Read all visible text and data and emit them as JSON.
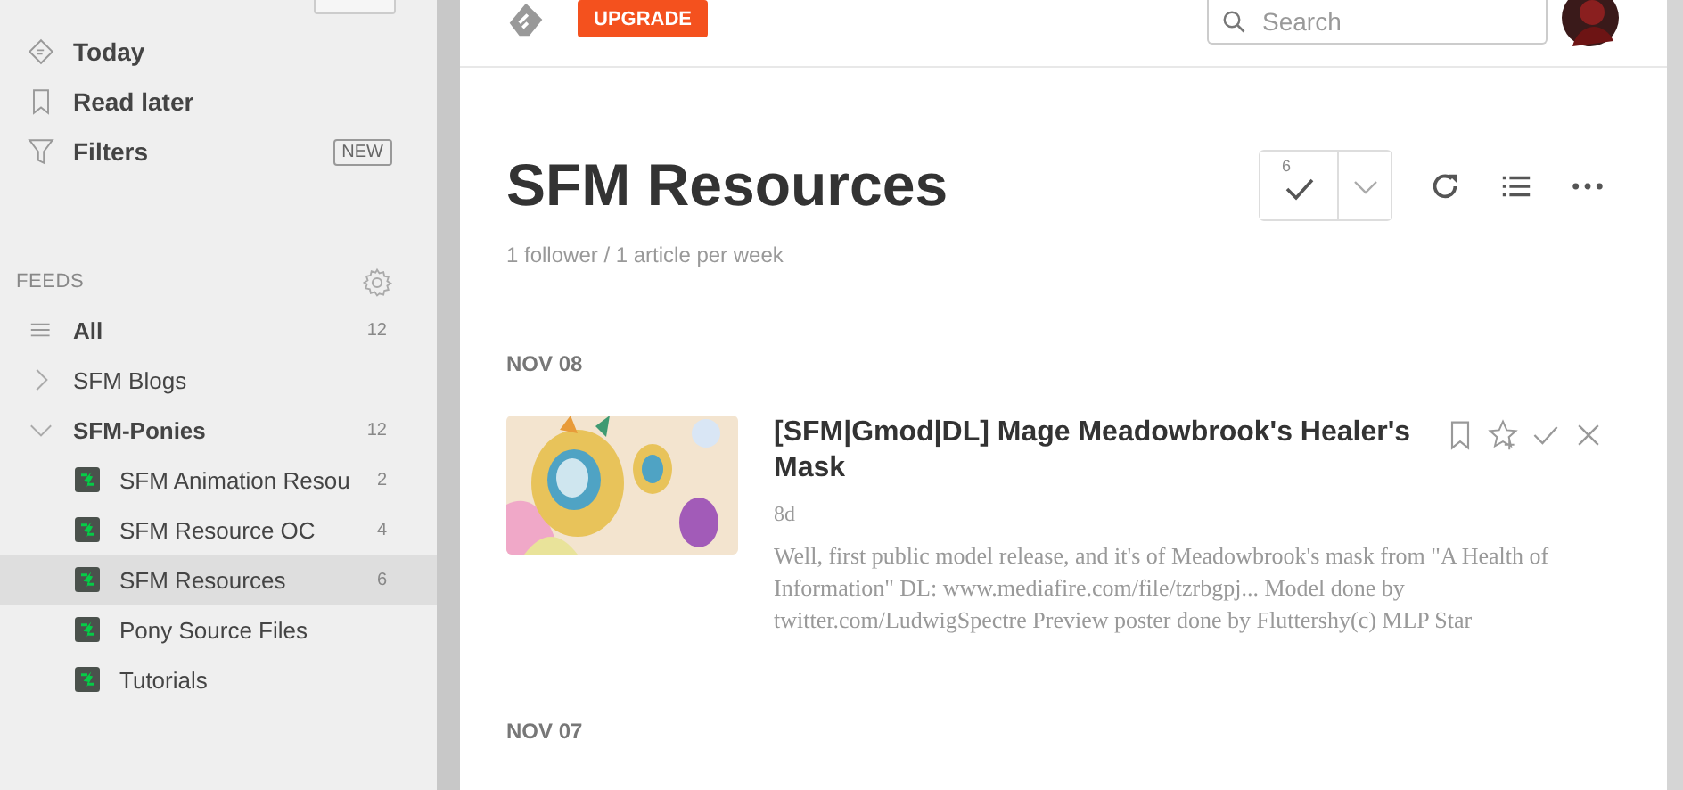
{
  "sidebar": {
    "nav": [
      {
        "kind": "today",
        "label": "Today"
      },
      {
        "kind": "later",
        "label": "Read later"
      },
      {
        "kind": "filter",
        "label": "Filters",
        "badge": "NEW"
      }
    ],
    "feeds_header": "FEEDS",
    "feeds": [
      {
        "kind": "all",
        "label": "All",
        "count": "12",
        "selected": false
      },
      {
        "kind": "folder",
        "label": "SFM Blogs",
        "expanded": false,
        "selected": false
      },
      {
        "kind": "folder",
        "label": "SFM-Ponies",
        "expanded": true,
        "count": "12",
        "selected": false,
        "children": [
          {
            "label": "SFM Animation Resou",
            "count": "2",
            "selected": false
          },
          {
            "label": "SFM Resource OC",
            "count": "4",
            "selected": false
          },
          {
            "label": "SFM Resources",
            "count": "6",
            "selected": true
          },
          {
            "label": "Pony Source Files",
            "selected": false
          },
          {
            "label": "Tutorials",
            "selected": false
          }
        ]
      }
    ]
  },
  "topbar": {
    "upgrade": "UPGRADE",
    "search": {
      "placeholder": "Search"
    }
  },
  "feed": {
    "title": "SFM Resources",
    "subtitle": "1 follower / 1 article per week",
    "unread_count": "6"
  },
  "days": [
    {
      "date": "NOV 08",
      "articles": [
        {
          "title": "[SFM|Gmod|DL] Mage Meadowbrook's Healer's Mask",
          "age": "8d",
          "summary": "Well, first public model release, and it's of Meadowbrook's mask from \"A Health of Information\" DL: www.mediafire.com/file/tzrbgpj... Model done by twitter.com/LudwigSpectre Preview poster done by Fluttershy(c) MLP Star"
        }
      ]
    },
    {
      "date": "NOV 07"
    }
  ]
}
